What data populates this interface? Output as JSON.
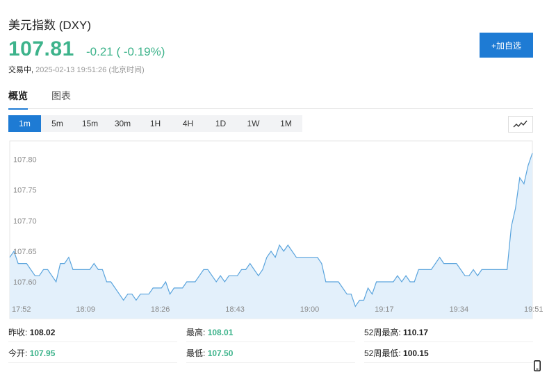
{
  "header": {
    "title": "美元指数 (DXY)",
    "price": "107.81",
    "change": "-0.21 ( -0.19%)",
    "status_prefix": "交易中,",
    "timestamp": "2025-02-13 19:51:26 (北京时间)",
    "add_button": "+加自选"
  },
  "tabs": [
    {
      "label": "概览",
      "active": true
    },
    {
      "label": "图表",
      "active": false
    }
  ],
  "periods": [
    "1m",
    "5m",
    "15m",
    "30m",
    "1H",
    "4H",
    "1D",
    "1W",
    "1M"
  ],
  "active_period": "1m",
  "colors": {
    "accent": "#1e7bd4",
    "up_down": "#3db38b",
    "line": "#5aa4dd",
    "fill": "#e3f0fb"
  },
  "stats": {
    "prev_close": {
      "label": "昨收:",
      "value": "108.02"
    },
    "high": {
      "label": "最高:",
      "value": "108.01"
    },
    "week52_high": {
      "label": "52周最高:",
      "value": "110.17"
    },
    "open": {
      "label": "今开:",
      "value": "107.95"
    },
    "low": {
      "label": "最低:",
      "value": "107.50"
    },
    "week52_low": {
      "label": "52周最低:",
      "value": "100.15"
    }
  },
  "chart_data": {
    "type": "area",
    "ylim": [
      107.54,
      107.83
    ],
    "yticks": [
      107.6,
      107.65,
      107.7,
      107.75,
      107.8
    ],
    "xticks": [
      "17:52",
      "18:09",
      "18:26",
      "18:43",
      "19:00",
      "19:17",
      "19:34",
      "19:51"
    ],
    "x_range_minutes": [
      0,
      119
    ],
    "values": [
      107.64,
      107.65,
      107.63,
      107.63,
      107.63,
      107.62,
      107.61,
      107.61,
      107.62,
      107.62,
      107.61,
      107.6,
      107.63,
      107.63,
      107.64,
      107.62,
      107.62,
      107.62,
      107.62,
      107.62,
      107.63,
      107.62,
      107.62,
      107.6,
      107.6,
      107.59,
      107.58,
      107.57,
      107.58,
      107.58,
      107.57,
      107.58,
      107.58,
      107.58,
      107.59,
      107.59,
      107.59,
      107.6,
      107.58,
      107.59,
      107.59,
      107.59,
      107.6,
      107.6,
      107.6,
      107.61,
      107.62,
      107.62,
      107.61,
      107.6,
      107.61,
      107.6,
      107.61,
      107.61,
      107.61,
      107.62,
      107.62,
      107.63,
      107.62,
      107.61,
      107.62,
      107.64,
      107.65,
      107.64,
      107.66,
      107.65,
      107.66,
      107.65,
      107.64,
      107.64,
      107.64,
      107.64,
      107.64,
      107.64,
      107.63,
      107.6,
      107.6,
      107.6,
      107.6,
      107.59,
      107.58,
      107.58,
      107.56,
      107.57,
      107.57,
      107.59,
      107.58,
      107.6,
      107.6,
      107.6,
      107.6,
      107.6,
      107.61,
      107.6,
      107.61,
      107.6,
      107.6,
      107.62,
      107.62,
      107.62,
      107.62,
      107.63,
      107.64,
      107.63,
      107.63,
      107.63,
      107.63,
      107.62,
      107.61,
      107.61,
      107.62,
      107.61,
      107.62,
      107.62,
      107.62,
      107.62,
      107.62,
      107.62,
      107.62,
      107.69,
      107.72,
      107.77,
      107.76,
      107.79,
      107.81
    ]
  }
}
